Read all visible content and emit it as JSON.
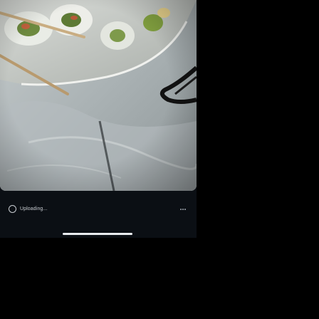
{
  "upload": {
    "status_label": "Uploading..."
  },
  "icons": {
    "status": "spinner-icon",
    "menu": "more-icon"
  },
  "colors": {
    "background": "#000000",
    "panel": "#0b0f14",
    "text": "#c9cdd2",
    "home_indicator": "#e9ecef"
  }
}
